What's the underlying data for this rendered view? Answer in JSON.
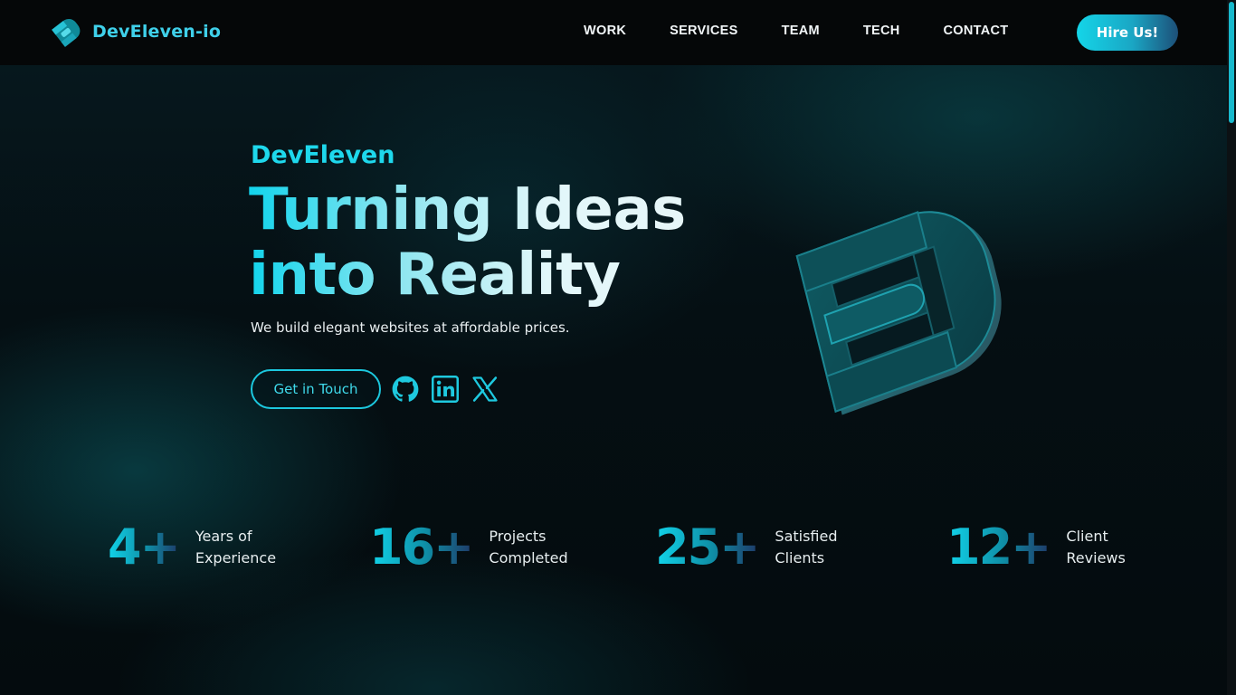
{
  "nav": {
    "brand_name": "DevEleven-io",
    "brand_logo_icon": "develeven-logo-icon",
    "links": [
      {
        "label": "WORK"
      },
      {
        "label": "SERVICES"
      },
      {
        "label": "TEAM"
      },
      {
        "label": "TECH"
      },
      {
        "label": "CONTACT"
      }
    ],
    "hire_label": "Hire Us!"
  },
  "hero": {
    "eyebrow": "DevEleven",
    "headline_line1": "Turning Ideas",
    "headline_line2": "into Reality",
    "subtitle": "We build elegant websites at affordable prices.",
    "cta_label": "Get in Touch",
    "socials": [
      "github-icon",
      "linkedin-icon",
      "x-icon"
    ],
    "graphic_icon": "develeven-3d-logo-icon"
  },
  "stats": [
    {
      "value": "4+",
      "label_line1": "Years of",
      "label_line2": "Experience"
    },
    {
      "value": "16+",
      "label_line1": "Projects",
      "label_line2": "Completed"
    },
    {
      "value": "25+",
      "label_line1": "Satisfied",
      "label_line2": "Clients"
    },
    {
      "value": "12+",
      "label_line1": "Client",
      "label_line2": "Reviews"
    }
  ],
  "colors": {
    "accent": "#1ed8ec",
    "background": "#050b0e",
    "navbar": "#050708"
  }
}
